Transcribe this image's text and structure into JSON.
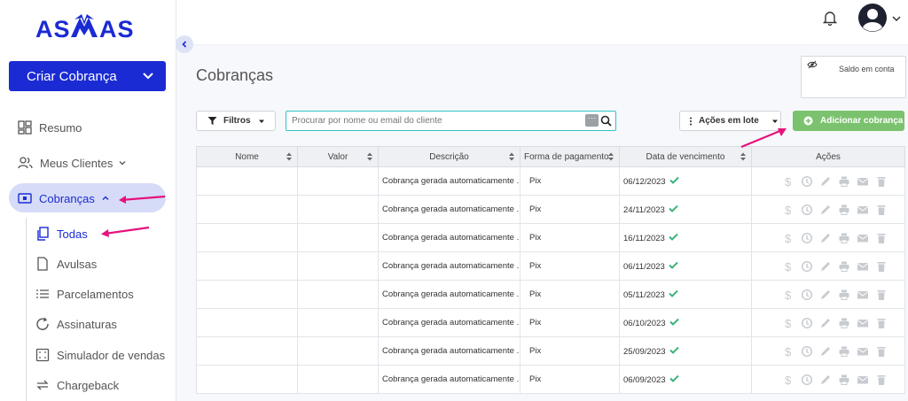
{
  "brand": {
    "name": "ASAAS"
  },
  "sidebar": {
    "create_label": "Criar Cobrança",
    "items": [
      {
        "label": "Resumo"
      },
      {
        "label": "Meus Clientes"
      },
      {
        "label": "Cobranças"
      }
    ],
    "sub_items": [
      {
        "label": "Todas"
      },
      {
        "label": "Avulsas"
      },
      {
        "label": "Parcelamentos"
      },
      {
        "label": "Assinaturas"
      },
      {
        "label": "Simulador de vendas"
      },
      {
        "label": "Chargeback"
      }
    ]
  },
  "page": {
    "title": "Cobranças",
    "saldo_label": "Saldo em conta"
  },
  "toolbar": {
    "filter_label": "Filtros",
    "search_placeholder": "Procurar por nome ou email do cliente",
    "batch_label": "Ações em lote",
    "add_label": "Adicionar cobrança"
  },
  "table": {
    "headers": [
      "Nome",
      "Valor",
      "Descrição",
      "Forma de pagamento",
      "Data de vencimento",
      "Ações"
    ],
    "rows": [
      {
        "nome": "",
        "valor": "",
        "descricao": "Cobrança gerada automaticamente ...",
        "forma": "Pix",
        "data": "06/12/2023"
      },
      {
        "nome": "",
        "valor": "",
        "descricao": "Cobrança gerada automaticamente ...",
        "forma": "Pix",
        "data": "24/11/2023"
      },
      {
        "nome": "",
        "valor": "",
        "descricao": "Cobrança gerada automaticamente ...",
        "forma": "Pix",
        "data": "16/11/2023"
      },
      {
        "nome": "",
        "valor": "",
        "descricao": "Cobrança gerada automaticamente ...",
        "forma": "Pix",
        "data": "06/11/2023"
      },
      {
        "nome": "",
        "valor": "",
        "descricao": "Cobrança gerada automaticamente ...",
        "forma": "Pix",
        "data": "05/11/2023"
      },
      {
        "nome": "",
        "valor": "",
        "descricao": "Cobrança gerada automaticamente ...",
        "forma": "Pix",
        "data": "06/10/2023"
      },
      {
        "nome": "",
        "valor": "",
        "descricao": "Cobrança gerada automaticamente ...",
        "forma": "Pix",
        "data": "25/09/2023"
      },
      {
        "nome": "",
        "valor": "",
        "descricao": "Cobrança gerada automaticamente ...",
        "forma": "Pix",
        "data": "06/09/2023"
      }
    ]
  },
  "colors": {
    "primary": "#1b2bd3",
    "add_green": "#7bc26e",
    "check_green": "#3bb37a",
    "annotation_arrow": "#e6127d"
  }
}
